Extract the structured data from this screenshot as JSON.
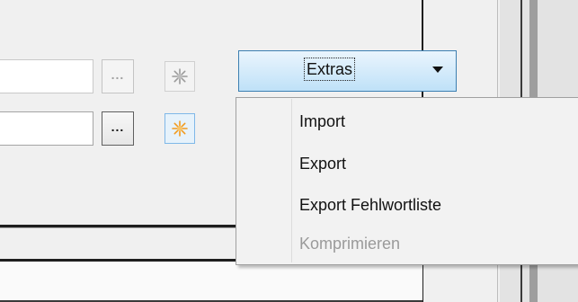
{
  "toolbar": {
    "extras_label": "Extras",
    "ellipsis_label_1": "...",
    "ellipsis_label_2": "..."
  },
  "menu": {
    "items": [
      {
        "label": "Import",
        "enabled": true
      },
      {
        "label": "Export",
        "enabled": true
      },
      {
        "label": "Export Fehlwortliste",
        "enabled": true
      },
      {
        "label": "Komprimieren",
        "enabled": false
      }
    ]
  },
  "colors": {
    "accent_border": "#3c7fb1",
    "sparkle_active": "#f29a1e",
    "sparkle_inactive": "#9a9a9a",
    "disabled_text": "#9a9a9a"
  }
}
